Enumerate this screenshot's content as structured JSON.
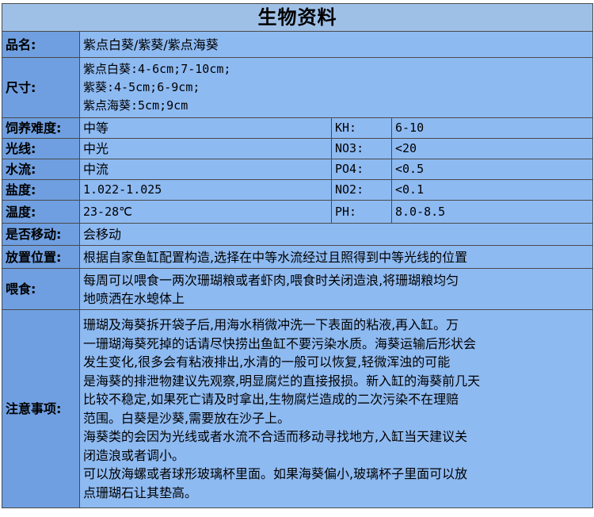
{
  "title": "生物资料",
  "rows": {
    "name": {
      "label": "品名:",
      "value": "紫点白葵/紫葵/紫点海葵"
    },
    "size": {
      "label": "尺寸:",
      "lines": [
        "紫点白葵:4-6cm;7-10cm;",
        "紫葵:4-5cm;6-9cm;",
        "紫点海葵:5cm;9cm"
      ]
    },
    "difficulty": {
      "label": "饲养难度:",
      "value": "中等",
      "param_label": "KH:",
      "param_value": "6-10"
    },
    "light": {
      "label": "光线:",
      "value": "中光",
      "param_label": "NO3:",
      "param_value": "<20"
    },
    "flow": {
      "label": "水流:",
      "value": "中流",
      "param_label": "PO4:",
      "param_value": "<0.5"
    },
    "salinity": {
      "label": "盐度:",
      "value": "1.022-1.025",
      "param_label": "NO2:",
      "param_value": "<0.1"
    },
    "temperature": {
      "label": "温度:",
      "value": "23-28℃",
      "param_label": "PH:",
      "param_value": "8.0-8.5"
    },
    "moving": {
      "label": "是否移动:",
      "value": "会移动"
    },
    "placement": {
      "label": "放置位置:",
      "value": "根据自家鱼缸配置构造,选择在中等水流经过且照得到中等光线的位置"
    },
    "feeding": {
      "label": "喂食:",
      "lines": [
        "每周可以喂食一两次珊瑚粮或者虾肉,喂食时关闭造浪,将珊瑚粮均匀",
        "地喷洒在水螅体上"
      ]
    },
    "notes": {
      "label": "注意事项:",
      "lines": [
        "珊瑚及海葵拆开袋子后,用海水稍微冲洗一下表面的粘液,再入缸。万",
        "一珊瑚海葵死掉的话请尽快捞出鱼缸不要污染水质。海葵运输后形状会",
        "发生变化,很多会有粘液排出,水清的一般可以恢复,轻微浑浊的可能",
        "是海葵的排泄物建议先观察,明显腐烂的直接报损。新入缸的海葵前几天",
        "比较不稳定,如果死亡请及时拿出,生物腐烂造成的二次污染不在理赔",
        "范围。白葵是沙葵,需要放在沙子上。",
        "海葵类的会因为光线或者水流不合适而移动寻找地方,入缸当天建议关",
        "闭造浪或者调小。",
        "可以放海螺或者球形玻璃杯里面。如果海葵偏小,玻璃杯子里面可以放",
        "点珊瑚石让其垫高。"
      ]
    }
  }
}
